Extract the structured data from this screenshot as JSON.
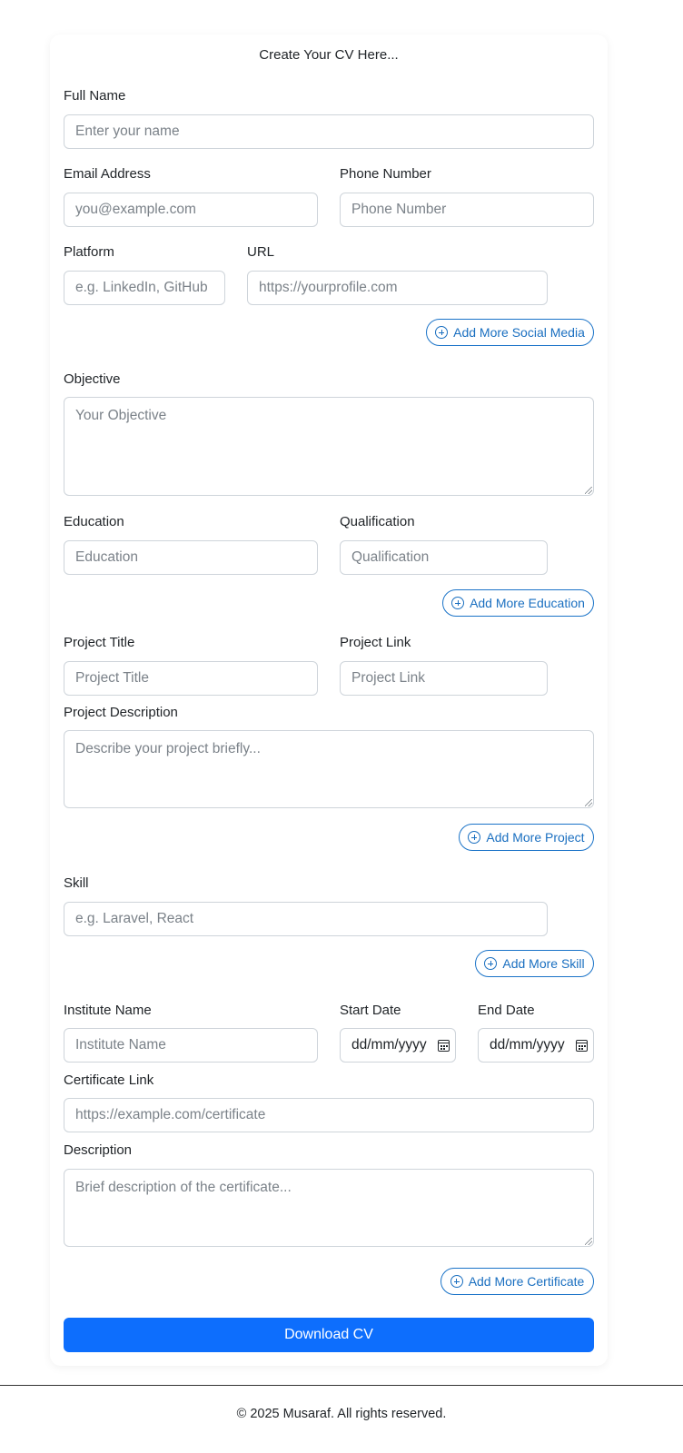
{
  "form": {
    "title": "Create Your CV Here...",
    "full_name": {
      "label": "Full Name",
      "placeholder": "Enter your name"
    },
    "email": {
      "label": "Email Address",
      "placeholder": "you@example.com"
    },
    "phone": {
      "label": "Phone Number",
      "placeholder": "Phone Number"
    },
    "platform": {
      "label": "Platform",
      "placeholder": "e.g. LinkedIn, GitHub"
    },
    "url": {
      "label": "URL",
      "placeholder": "https://yourprofile.com"
    },
    "add_social": "Add More Social Media",
    "objective": {
      "label": "Objective",
      "placeholder": "Your Objective"
    },
    "education": {
      "label": "Education",
      "placeholder": "Education"
    },
    "qualification": {
      "label": "Qualification",
      "placeholder": "Qualification"
    },
    "add_education": "Add More Education",
    "project_title": {
      "label": "Project Title",
      "placeholder": "Project Title"
    },
    "project_link": {
      "label": "Project Link",
      "placeholder": "Project Link"
    },
    "project_description": {
      "label": "Project Description",
      "placeholder": "Describe your project briefly..."
    },
    "add_project": "Add More Project",
    "skill": {
      "label": "Skill",
      "placeholder": "e.g. Laravel, React"
    },
    "add_skill": "Add More Skill",
    "institute": {
      "label": "Institute Name",
      "placeholder": "Institute Name"
    },
    "start_date": {
      "label": "Start Date",
      "value": "dd/mm/yyyy"
    },
    "end_date": {
      "label": "End Date",
      "value": "dd/mm/yyyy"
    },
    "certificate_link": {
      "label": "Certificate Link",
      "placeholder": "https://example.com/certificate"
    },
    "description": {
      "label": "Description",
      "placeholder": "Brief description of the certificate..."
    },
    "add_certificate": "Add More Certificate",
    "download": "Download CV"
  },
  "footer": {
    "text": "© 2025 Musaraf. All rights reserved."
  },
  "colors": {
    "primary": "#0d6efd",
    "outline": "#1a73c8",
    "border": "#ced4da"
  }
}
